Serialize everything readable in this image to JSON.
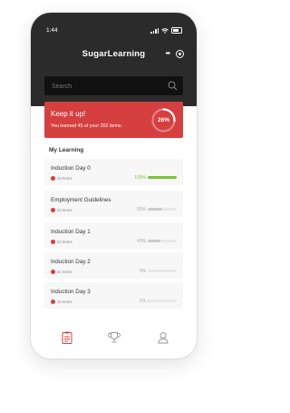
{
  "status_bar": {
    "time": "1:44"
  },
  "app": {
    "title": "SugarLearning",
    "menu_dots": "•••"
  },
  "search": {
    "placeholder": "Search"
  },
  "banner": {
    "heading": "Keep it up!",
    "subtext": "You learned 45 of your 202 items.",
    "progress_percent": 26,
    "progress_label": "26%",
    "color": "#d53f3f"
  },
  "section_title": "My Learning",
  "courses": [
    {
      "title": "Induction Day 0",
      "items": "15 Items",
      "percent": 100,
      "percent_label": "100%"
    },
    {
      "title": "Employment Guidelines",
      "items": "23 Items",
      "percent": 50,
      "percent_label": "50%"
    },
    {
      "title": "Induction Day 1",
      "items": "22 Items",
      "percent": 43,
      "percent_label": "43%"
    },
    {
      "title": "Induction Day 2",
      "items": "21 Items",
      "percent": 0,
      "percent_label": "0%"
    },
    {
      "title": "Induction Day 3",
      "items": "15 Items",
      "percent": 2,
      "percent_label": "2%"
    }
  ],
  "tabs": [
    {
      "name": "learning-tab",
      "icon": "clipboard-icon",
      "active": true
    },
    {
      "name": "achievements-tab",
      "icon": "trophy-icon",
      "active": false
    },
    {
      "name": "profile-tab",
      "icon": "user-icon",
      "active": false
    }
  ],
  "colors": {
    "accent": "#d53f3f",
    "complete": "#7cc23a",
    "header": "#2b2b2b"
  }
}
